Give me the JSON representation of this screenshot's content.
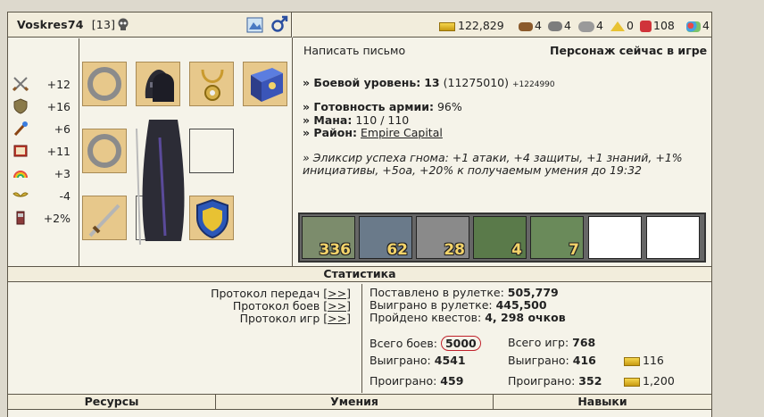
{
  "header": {
    "name": "Voskres74",
    "level": "[13]",
    "resources": [
      {
        "icon": "gold-icon",
        "value": "122,829"
      },
      {
        "icon": "wood-icon",
        "value": "4"
      },
      {
        "icon": "ore-icon",
        "value": "4"
      },
      {
        "icon": "mercury-icon",
        "value": "4"
      },
      {
        "icon": "sulfur-icon",
        "value": "0"
      },
      {
        "icon": "crystal-icon",
        "value": "108"
      },
      {
        "icon": "gems-icon",
        "value": "4"
      }
    ]
  },
  "stats": {
    "attack": "+12",
    "defense": "+16",
    "spellpower": "+6",
    "knowledge": "+11",
    "luck": "+3",
    "morale": "-4",
    "initiative": "+2%"
  },
  "actions": {
    "write_letter": "Написать письмо",
    "online_status": "Персонаж сейчас в игре"
  },
  "info": {
    "combat_level_label": "» Боевой уровень:",
    "combat_level": "13",
    "experience": "(11275010)",
    "experience_gain": "+1224990",
    "army_ready_label": "» Готовность армии:",
    "army_ready": "96%",
    "mana_label": "» Мана:",
    "mana": "110 / 110",
    "district_label": "» Район:",
    "district": "Empire Capital",
    "elixir_line1": "» Эликсир успеха гнома: +1 атаки, +4 защиты, +1 знаний, +1%",
    "elixir_line2": "инициативы, +5oa, +20% к получаемым умения до 19:32"
  },
  "army": [
    {
      "count": "336"
    },
    {
      "count": "62"
    },
    {
      "count": "28"
    },
    {
      "count": "4"
    },
    {
      "count": "7"
    },
    {
      "count": ""
    },
    {
      "count": ""
    }
  ],
  "statistics": {
    "title": "Статистика",
    "protocol_transfers": "Протокол передач",
    "protocol_battles": "Протокол боев",
    "protocol_games": "Протокол игр",
    "protocol_link": "[>>]",
    "roulette_bet_label": "Поставлено в рулетке:",
    "roulette_bet": "505,779",
    "roulette_won_label": "Выиграно в рулетке:",
    "roulette_won": "445,500",
    "quests_label": "Пройдено квестов:",
    "quests": "4, 298 очков",
    "total_battles_label": "Всего боев:",
    "total_battles": "5000",
    "won_battles_label": "Выиграно:",
    "won_battles": "4541",
    "lost_battles_label": "Проиграно:",
    "lost_battles": "459",
    "total_games_label": "Всего игр:",
    "total_games": "768",
    "won_games_label": "Выиграно:",
    "won_games": "416",
    "lost_games_label": "Проиграно:",
    "lost_games": "352",
    "gold_won": "116",
    "gold_lost": "1,200"
  },
  "bottom": {
    "resources": "Ресурсы",
    "skills": "Умения",
    "talents": "Навыки"
  }
}
